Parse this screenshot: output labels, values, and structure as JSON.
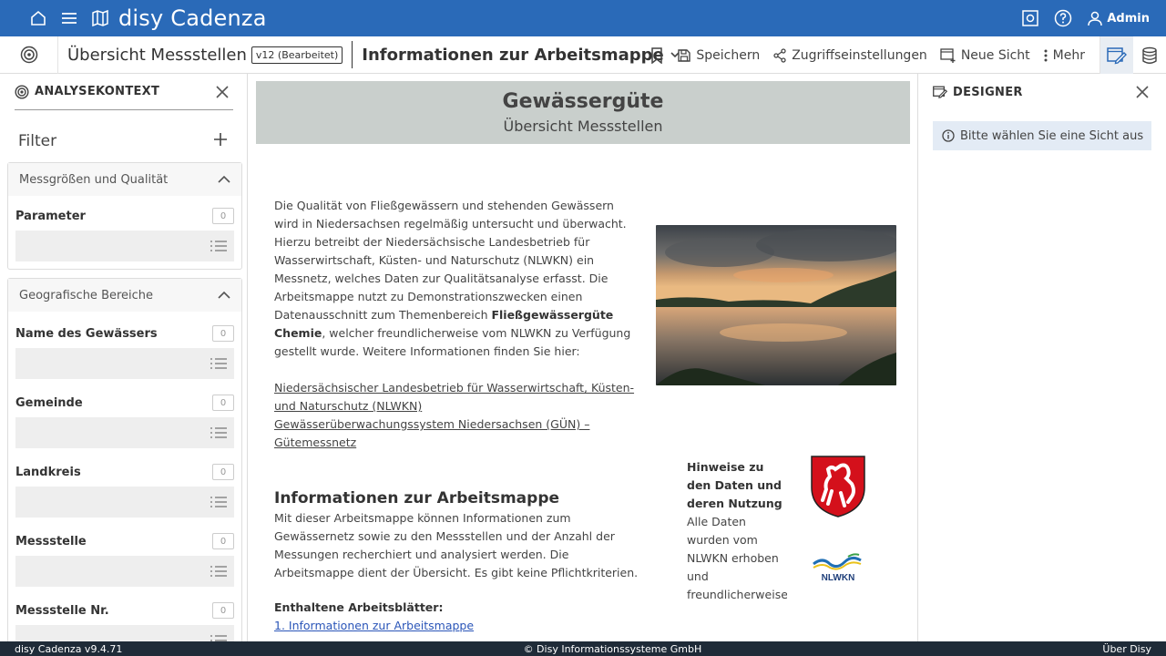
{
  "app": {
    "brand": "disy Cadenza",
    "user_label": "Admin"
  },
  "toolbar": {
    "workbook_title": "Übersicht Messstellen",
    "version_badge": "v12 (Bearbeitet)",
    "sheet_title": "Informationen zur Arbeitsmappe",
    "save_label": "Speichern",
    "access_label": "Zugriffseinstellungen",
    "new_view_label": "Neue Sicht",
    "more_label": "Mehr"
  },
  "analysis_panel": {
    "title": "ANALYSEKONTEXT",
    "filter_label": "Filter",
    "groups": [
      {
        "title": "Messgrößen und Qualität",
        "params": [
          {
            "label": "Parameter",
            "count": "0"
          }
        ]
      },
      {
        "title": "Geografische Bereiche",
        "params": [
          {
            "label": "Name des Gewässers",
            "count": "0"
          },
          {
            "label": "Gemeinde",
            "count": "0"
          },
          {
            "label": "Landkreis",
            "count": "0"
          },
          {
            "label": "Messstelle",
            "count": "0"
          },
          {
            "label": "Messstelle Nr.",
            "count": "0"
          }
        ]
      }
    ]
  },
  "content": {
    "hero_title": "Gewässergüte",
    "hero_subtitle": "Übersicht Messstellen",
    "intro_part1": "Die Qualität von Fließgewässern und stehenden Gewässern wird in Niedersachsen regelmäßig untersucht und überwacht. Hierzu betreibt der Niedersächsische Landesbetrieb für Wasserwirtschaft, Küsten- und Naturschutz (NLWKN) ein Messnetz, welches Daten zur Qualitätsanalyse erfasst. Die Arbeitsmappe nutzt zu Demonstrationszwecken einen Datenausschnitt zum Themenbereich ",
    "intro_bold": "Fließgewässergüte Chemie",
    "intro_part2": ", welcher freundlicherweise vom NLWKN zu Verfügung gestellt wurde. Weitere Informationen finden Sie hier:",
    "link1": "Niedersächsischer Landesbetrieb für Wasserwirtschaft, Küsten- und Naturschutz (NLWKN)",
    "link2": "Gewässerüberwachungssystem Niedersachsen (GÜN) – Gütemessnetz",
    "section_title": "Informationen zur Arbeitsmappe",
    "section_text": "Mit dieser Arbeitsmappe können Informationen zum Gewässernetz sowie zu den Messstellen und der Anzahl der Messungen recherchiert und analysiert werden. Die Arbeitsmappe dient der Übersicht. Es gibt keine Pflichtkriterien.",
    "sheets_label": "Enthaltene Arbeitsblätter:",
    "sheet_link": "1. Informationen zur Arbeitsmappe",
    "notes_title": "Hinweise zu den Daten und deren Nutzung",
    "notes_text": "Alle Daten wurden vom NLWKN erhoben und freundlicherweise zu Demonstrationszwecken",
    "nlwkn_logo_text": "NLWKN"
  },
  "designer_panel": {
    "title": "DESIGNER",
    "info": "Bitte wählen Sie eine Sicht aus"
  },
  "footer": {
    "version": "disy Cadenza v9.4.71",
    "copyright": "© Disy Informationssysteme GmbH",
    "about": "Über Disy"
  },
  "colors": {
    "topbar": "#2a6ab8",
    "footer": "#1f2b38",
    "hero": "#c9cfcc",
    "info": "#e3ebf5"
  }
}
